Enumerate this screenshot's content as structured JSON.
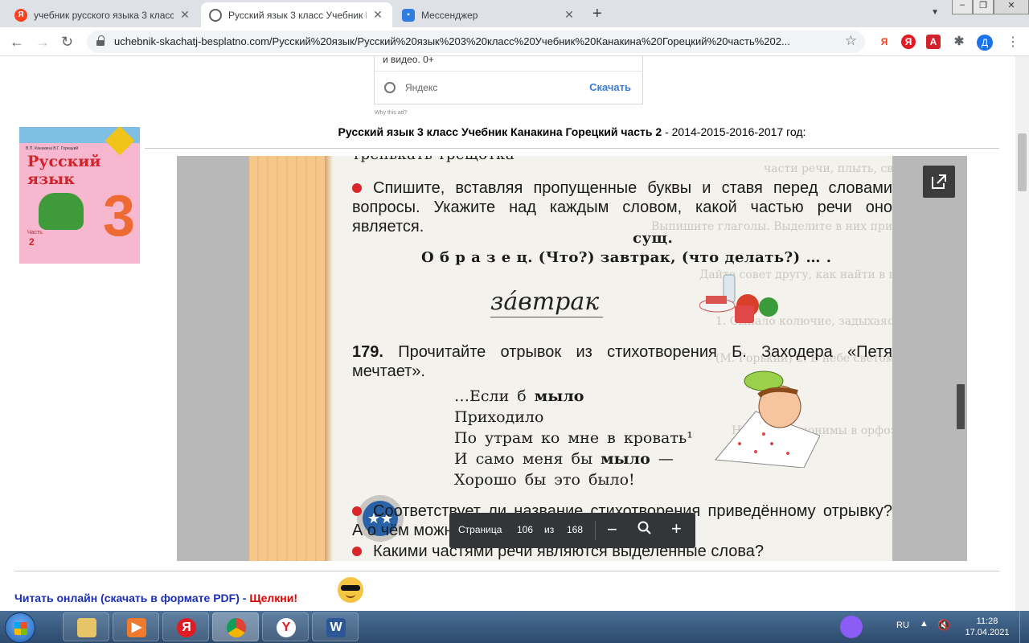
{
  "browser": {
    "tabs": [
      {
        "title": "учебник русского языка 3 класс",
        "favicon": "yandex-favicon",
        "active": false
      },
      {
        "title": "Русский язык 3 класс Учебник К",
        "favicon": "globe-favicon",
        "active": true
      },
      {
        "title": "Мессенджер",
        "favicon": "messenger-favicon",
        "active": false
      }
    ],
    "url": "uchebnik-skachatj-besplatno.com/Русский%20язык/Русский%20язык%203%20класс%20Учебник%20Канакина%20Горецкий%20часть%202...",
    "profile_letter": "Д",
    "accent": "#1a73e8"
  },
  "ad": {
    "line1": "и видео. 0+",
    "source": "Яндекс",
    "button": "Скачать",
    "why": "Why this ad?"
  },
  "cover": {
    "authors": "В.П. Канакина    В.Г. Горецкий",
    "title1": "Русский",
    "title2": "язык",
    "grade": "3",
    "part_label": "Часть",
    "part_num": "2"
  },
  "heading": {
    "bold": "Русский язык 3 класс Учебник Канакина Горецкий часть 2",
    "rest": " - 2014-2015-2016-2017 год:"
  },
  "book": {
    "top_cut": "тренькать  трещотка",
    "task1": "Спишите, вставляя пропущенные буквы и ставя перед словами вопросы. Укажите над каждым словом, какой частью речи оно является.",
    "abbr": "сущ.",
    "sample": "О б р а з е ц.  (Что?)  завтрак,  (что  делать?)  … .",
    "handwritten": "за́втрак",
    "ex_num": "179.",
    "ex_text": "Прочитайте отрывок из стихотворения Б. Заходера «Петя мечтает».",
    "poem": [
      {
        "a": "…Если б ",
        "b": "мыло",
        "c": ""
      },
      {
        "a": "Приходило",
        "b": "",
        "c": ""
      },
      {
        "a": "По утрам ко мне в кровать¹",
        "b": "",
        "c": ""
      },
      {
        "a": "И само меня бы ",
        "b": "мыло",
        "c": " —"
      },
      {
        "a": "Хорошо бы это было!",
        "b": "",
        "c": ""
      }
    ],
    "q1": "Соответствует ли название стихотворения приведённому отрывку? А о чём можно мечтать?",
    "q2": "Какими частями речи являются выделенные слова?"
  },
  "viewer": {
    "page_label": "Страница",
    "page": "106",
    "of": "из",
    "total": "168"
  },
  "footer": {
    "link": "Читать онлайн (скачать в формате PDF) - ",
    "link_red": "Щелкни!"
  },
  "taskbar": {
    "lang": "RU",
    "time": "11:28",
    "date": "17.04.2021"
  }
}
